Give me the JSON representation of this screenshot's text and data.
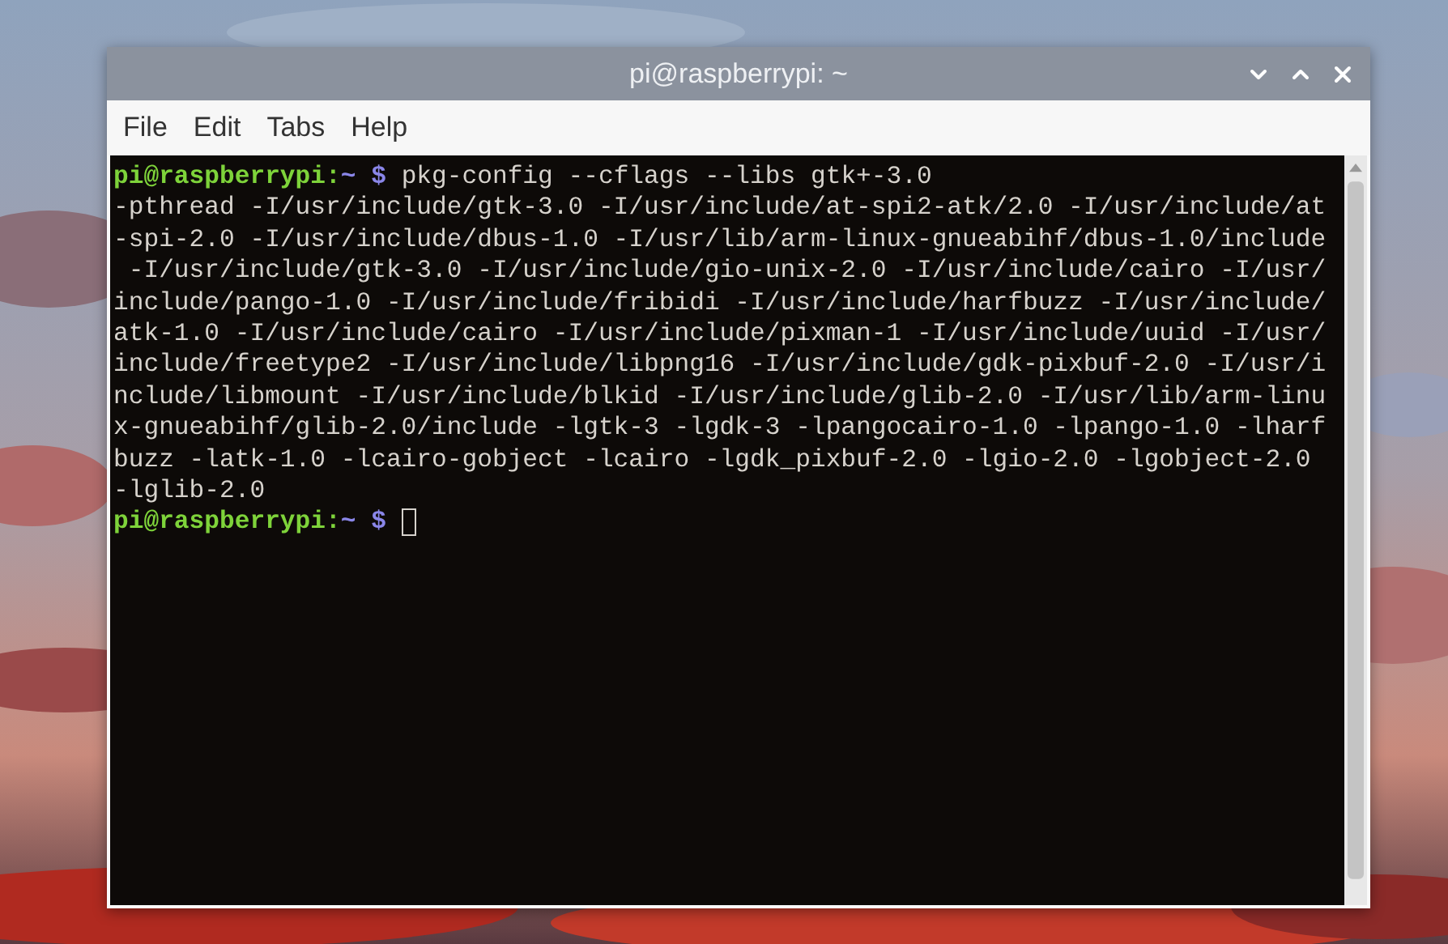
{
  "window": {
    "title": "pi@raspberrypi: ~"
  },
  "menu": [
    "File",
    "Edit",
    "Tabs",
    "Help"
  ],
  "terminal": {
    "lines": [
      {
        "kind": "prompt",
        "user_host": "pi@raspberrypi:",
        "path": "~",
        "symbol": "$",
        "command": "pkg-config --cflags --libs gtk+-3.0",
        "cursor": false
      },
      {
        "kind": "output",
        "text": "-pthread -I/usr/include/gtk-3.0 -I/usr/include/at-spi2-atk/2.0 -I/usr/include/at"
      },
      {
        "kind": "output",
        "text": "-spi-2.0 -I/usr/include/dbus-1.0 -I/usr/lib/arm-linux-gnueabihf/dbus-1.0/include"
      },
      {
        "kind": "output",
        "text": " -I/usr/include/gtk-3.0 -I/usr/include/gio-unix-2.0 -I/usr/include/cairo -I/usr/"
      },
      {
        "kind": "output",
        "text": "include/pango-1.0 -I/usr/include/fribidi -I/usr/include/harfbuzz -I/usr/include/"
      },
      {
        "kind": "output",
        "text": "atk-1.0 -I/usr/include/cairo -I/usr/include/pixman-1 -I/usr/include/uuid -I/usr/"
      },
      {
        "kind": "output",
        "text": "include/freetype2 -I/usr/include/libpng16 -I/usr/include/gdk-pixbuf-2.0 -I/usr/i"
      },
      {
        "kind": "output",
        "text": "nclude/libmount -I/usr/include/blkid -I/usr/include/glib-2.0 -I/usr/lib/arm-linu"
      },
      {
        "kind": "output",
        "text": "x-gnueabihf/glib-2.0/include -lgtk-3 -lgdk-3 -lpangocairo-1.0 -lpango-1.0 -lharf"
      },
      {
        "kind": "output",
        "text": "buzz -latk-1.0 -lcairo-gobject -lcairo -lgdk_pixbuf-2.0 -lgio-2.0 -lgobject-2.0"
      },
      {
        "kind": "output",
        "text": "-lglib-2.0"
      },
      {
        "kind": "prompt",
        "user_host": "pi@raspberrypi:",
        "path": "~",
        "symbol": "$",
        "cursor": true
      }
    ]
  }
}
